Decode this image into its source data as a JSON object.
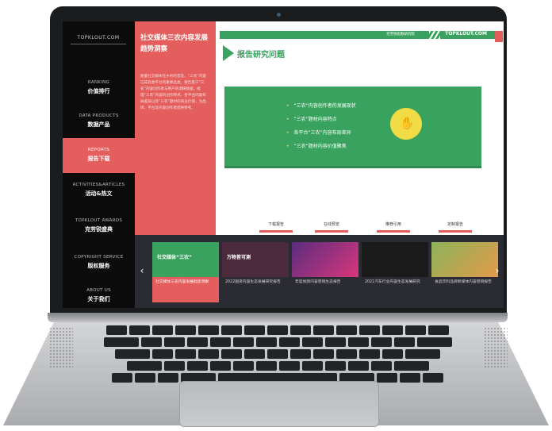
{
  "sidebar": {
    "logo": "TOPKLOUT.COM",
    "items": [
      {
        "en": "RANKING",
        "zh": "价值排行",
        "active": false
      },
      {
        "en": "DATA PRODUCTS",
        "zh": "数据产品",
        "active": false
      },
      {
        "en": "REPORTS",
        "zh": "报告下载",
        "active": true
      },
      {
        "en": "ACTIVITIES&ARTICLES",
        "zh": "活动&热文",
        "active": false
      },
      {
        "en": "TOPKLOUT AWARDS",
        "zh": "克劳锐盛典",
        "active": false
      },
      {
        "en": "COPYRIGHT SERVICE",
        "zh": "版权服务",
        "active": false
      },
      {
        "en": "ABOUT US",
        "zh": "关于我们",
        "active": false
      }
    ]
  },
  "report": {
    "title": "社交媒体三农内容发展趋势洞察",
    "description": "随着社交媒体在乡村的普及，“三农”内容已成各类平台的重要品类。报告基于“三农”内容创作者与用户的调研数据，梳理“三农”内容的创作特点、各平台内容布局差异以及“三农”题材的商业价值，为品牌、平台及内容创作者提供参考。"
  },
  "slide": {
    "tagline": "克劳锐指数研究院",
    "brand": "TOPKLOUT.COM",
    "heading": "报告研究问题",
    "questions": [
      "“三农”内容创作者的发展现状",
      "“三农”题材内容特点",
      "各平台“三农”内容布局差异",
      "“三农”题材内容价值聚焦"
    ],
    "hand_icon": "pointing-hand-icon"
  },
  "actions": [
    "下载报告",
    "在线预览",
    "推荐引用",
    "定制报告"
  ],
  "carousel": {
    "prev_icon": "chevron-left-icon",
    "next_icon": "chevron-right-icon",
    "cards": [
      {
        "thumb_text": "社交媒体“三农”",
        "caption": "社交媒体三农内容发展趋势洞察",
        "color": "#3aa25f"
      },
      {
        "thumb_text": "万物皆可测",
        "caption": "2022国货内容生态发展研究报告",
        "color": "#4b2a3c"
      },
      {
        "thumb_text": "",
        "caption": "年度视频内容营销生态报告",
        "color": "#5b2c80"
      },
      {
        "thumb_text": "",
        "caption": "2021汽车行业内容生态发展研究",
        "color": "#1a1a1a"
      },
      {
        "thumb_text": "",
        "caption": "食品饮料品牌新媒体内容营销报告",
        "color": "#8cb35a"
      }
    ]
  },
  "colors": {
    "accent_red": "#e35e5c",
    "accent_green": "#3aa25f",
    "sidebar_bg": "#0b0b0b"
  }
}
